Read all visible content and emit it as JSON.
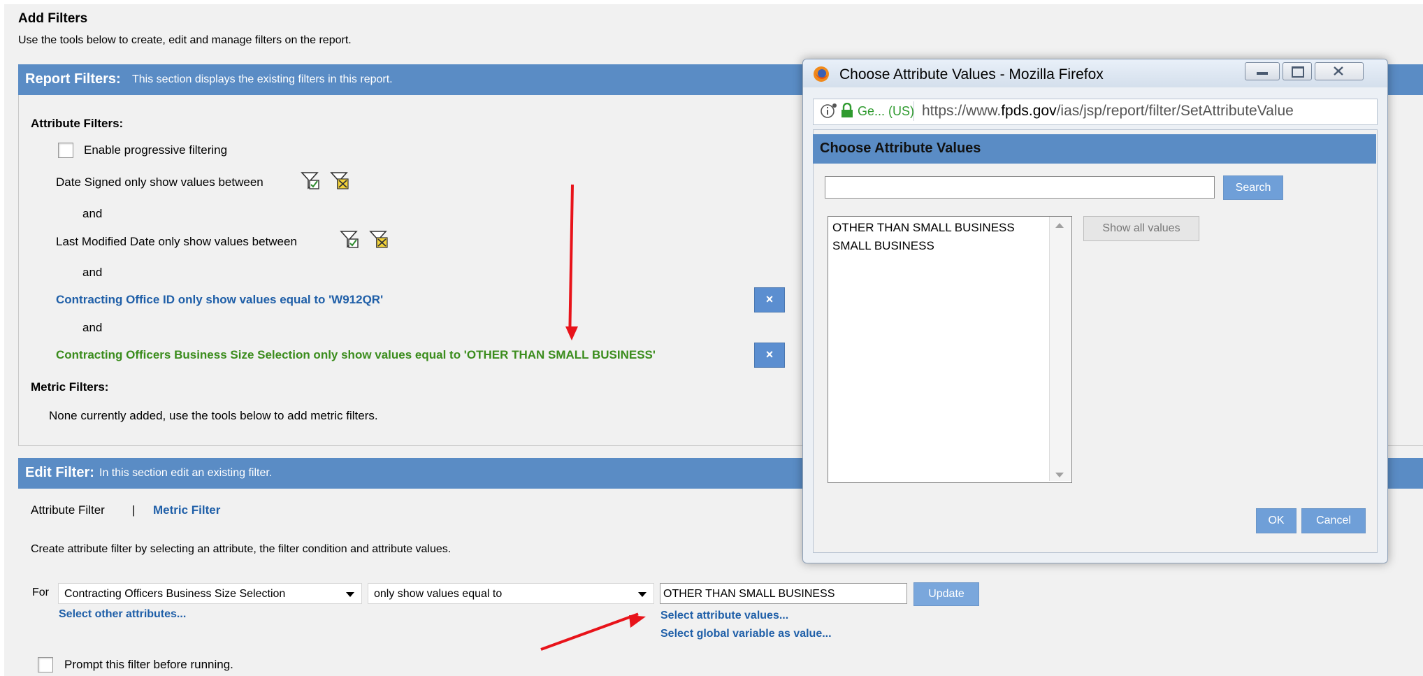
{
  "header": {
    "title": "Add Filters",
    "description": "Use the tools below to create, edit and manage filters on the report."
  },
  "report_filters": {
    "label": "Report Filters:",
    "description": "This section displays the existing filters in this report.",
    "attribute_filters_label": "Attribute Filters:",
    "progressive_label": "Enable progressive filtering",
    "date_signed": "Date Signed only show values between",
    "and": "and",
    "last_modified": "Last Modified Date only show values between",
    "office_filter": "Contracting Office ID only show values equal to 'W912QR'",
    "size_filter": "Contracting Officers Business Size Selection only show values equal to 'OTHER THAN SMALL BUSINESS'",
    "remove_symbol": "×",
    "metric_filters_label": "Metric Filters:",
    "metric_none": "None currently added, use the tools below to add metric filters."
  },
  "edit_filter": {
    "label": "Edit Filter:",
    "description": "In this section edit an existing filter.",
    "tab_attribute": "Attribute Filter",
    "tab_separator": "|",
    "tab_metric": "Metric Filter",
    "instructions": "Create attribute filter by selecting an attribute, the filter condition and attribute values.",
    "for_label": "For",
    "attribute_value": "Contracting Officers Business Size Selection",
    "condition_value": "only show values equal to",
    "value_input": "OTHER THAN SMALL BUSINESS",
    "update_label": "Update",
    "select_other": "Select other attributes...",
    "select_values": "Select attribute values...",
    "select_global": "Select global variable as value...",
    "prompt_label": "Prompt this filter before running."
  },
  "popup": {
    "window_title": "Choose Attribute Values - Mozilla Firefox",
    "url_site": "Ge... (US)",
    "url_prefix": "https://www.",
    "url_domain": "fpds.gov",
    "url_path": "/ias/jsp/report/filter/SetAttributeValue",
    "heading": "Choose Attribute Values",
    "search_value": "",
    "search_label": "Search",
    "values": [
      "OTHER THAN SMALL BUSINESS",
      "SMALL BUSINESS"
    ],
    "show_all_label": "Show all values",
    "ok_label": "OK",
    "cancel_label": "Cancel"
  },
  "colors": {
    "panel_header": "#5a8cc5",
    "link_blue": "#1f5fa8",
    "link_green": "#3a8c1c",
    "annotation_red": "#e8131a"
  }
}
